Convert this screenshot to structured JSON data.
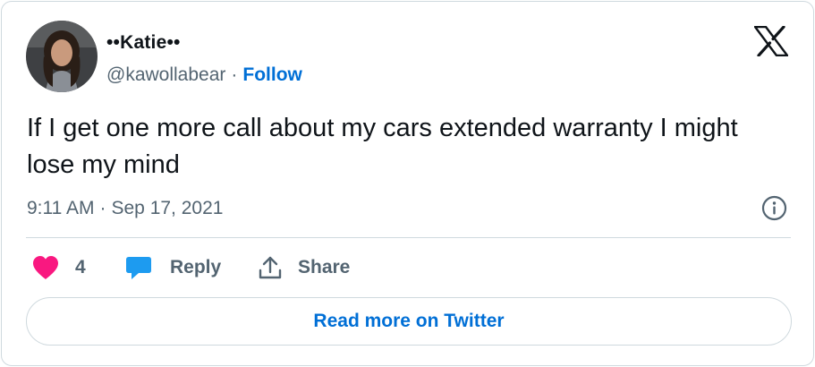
{
  "author": {
    "display_name": "••Katie••",
    "handle": "@kawollabear",
    "separator": "·",
    "follow_label": "Follow"
  },
  "tweet": {
    "text": "If I get one more call about my cars extended warranty I might lose my mind",
    "time": "9:11 AM",
    "separator": "·",
    "date": "Sep 17, 2021"
  },
  "actions": {
    "like_count": "4",
    "reply_label": "Reply",
    "share_label": "Share"
  },
  "read_more_label": "Read more on Twitter",
  "icons": {
    "brand": "x-logo-icon",
    "info": "info-icon",
    "like": "heart-icon",
    "reply": "speech-bubble-icon",
    "share": "share-upload-icon"
  },
  "colors": {
    "link": "#006fd6",
    "heart": "#f91880",
    "reply_bubble": "#1d9bf0",
    "muted_text": "#536471",
    "border": "#cfd9de"
  }
}
